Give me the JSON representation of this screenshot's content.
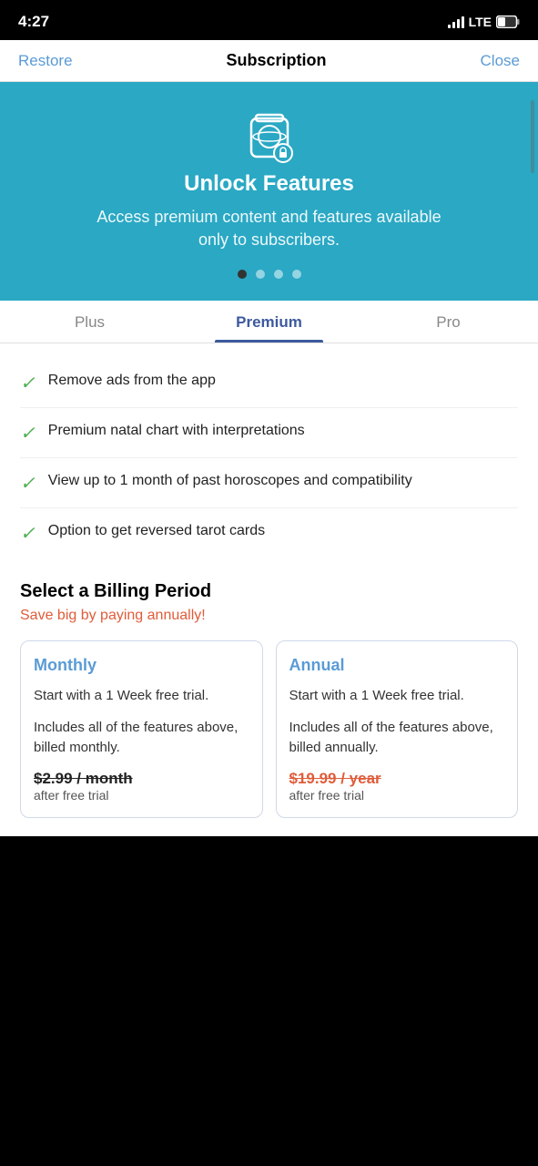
{
  "status_bar": {
    "time": "4:27",
    "signal_label": "LTE"
  },
  "nav": {
    "restore_label": "Restore",
    "title": "Subscription",
    "close_label": "Close"
  },
  "hero": {
    "title": "Unlock Features",
    "subtitle": "Access premium content and features available only to subscribers.",
    "dots": [
      true,
      false,
      false,
      false
    ]
  },
  "tabs": [
    {
      "label": "Plus",
      "active": false
    },
    {
      "label": "Premium",
      "active": true
    },
    {
      "label": "Pro",
      "active": false
    }
  ],
  "features": [
    {
      "text": "Remove ads from the app"
    },
    {
      "text": "Premium natal chart with interpretations"
    },
    {
      "text": "View up to 1 month of past horoscopes and compatibility"
    },
    {
      "text": "Option to get reversed tarot cards"
    }
  ],
  "billing": {
    "section_title": "Select a Billing Period",
    "save_text": "Save big by paying annually!",
    "cards": [
      {
        "title": "Monthly",
        "trial_text": "Start with a 1 Week free trial.",
        "includes_text": "Includes all of the features above, billed monthly.",
        "price": "$2.99 / month",
        "after_text": "after free trial"
      },
      {
        "title": "Annual",
        "trial_text": "Start with a 1 Week free trial.",
        "includes_text": "Includes all of the features above, billed annually.",
        "price": "$19.99 / year",
        "after_text": "after free trial"
      }
    ]
  }
}
